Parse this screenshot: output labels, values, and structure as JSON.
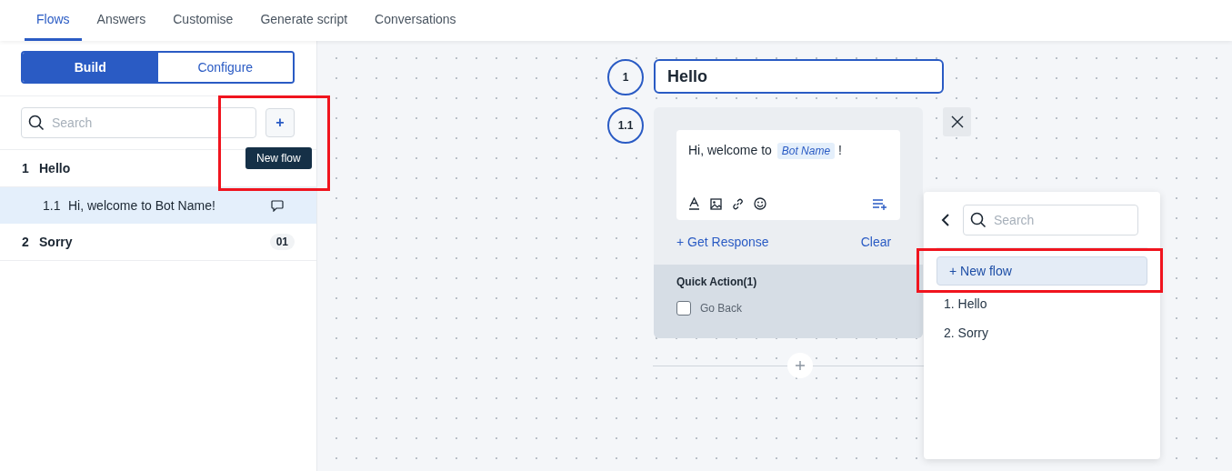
{
  "tabs": [
    {
      "label": "Flows",
      "selected": true
    },
    {
      "label": "Answers",
      "selected": false
    },
    {
      "label": "Customise",
      "selected": false
    },
    {
      "label": "Generate script",
      "selected": false
    },
    {
      "label": "Conversations",
      "selected": false
    }
  ],
  "sidebar": {
    "modes": [
      {
        "label": "Build",
        "selected": true
      },
      {
        "label": "Configure",
        "selected": false
      }
    ],
    "search": {
      "placeholder": "Search"
    },
    "add_button": {
      "label": "+",
      "highlighted": true,
      "tooltip": "New flow"
    },
    "flows": [
      {
        "number": "1",
        "name": "Hello",
        "children": [
          {
            "number": "1.1",
            "text": "Hi, welcome to Bot Name!",
            "selected": true
          }
        ]
      },
      {
        "number": "2",
        "name": "Sorry",
        "count": "01"
      }
    ]
  },
  "canvas": {
    "flow": {
      "number": "1",
      "title": "Hello"
    },
    "step": {
      "number": "1.1",
      "message": "Hi, welcome to ",
      "variable": "Bot Name",
      "message_end": "!",
      "get_response": "+ Get Response",
      "clear": "Clear",
      "quick_action_title": "Quick Action(1)",
      "quick_actions": [
        {
          "label": "Go Back",
          "checked": false
        }
      ]
    }
  },
  "flow_picker": {
    "search": {
      "placeholder": "Search"
    },
    "new_flow": {
      "label": "+ New flow",
      "highlighted": true
    },
    "flows": [
      "1. Hello",
      "2. Sorry"
    ]
  }
}
